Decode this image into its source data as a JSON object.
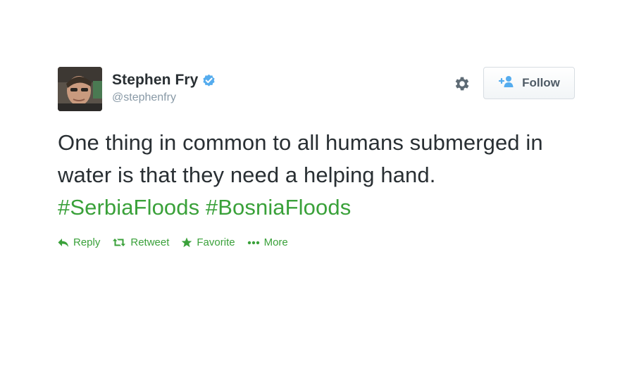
{
  "colors": {
    "accent": "#3aa13a",
    "text": "#292f33",
    "muted": "#8899a6",
    "verified": "#55acee",
    "follow_text": "#4f5b66"
  },
  "user": {
    "full_name": "Stephen Fry",
    "screen_name": "@stephenfry",
    "verified": true,
    "avatar_icon": "avatar"
  },
  "header": {
    "settings_icon": "gear-icon",
    "follow_label": "Follow",
    "follow_icon": "add-user-icon"
  },
  "tweet": {
    "text_main": "One thing in common to all humans submerged in water is that they need a helping hand.",
    "hashtags": [
      "#SerbiaFloods",
      "#BosniaFloods"
    ]
  },
  "actions": [
    {
      "label": "Reply",
      "icon": "reply-icon"
    },
    {
      "label": "Retweet",
      "icon": "retweet-icon"
    },
    {
      "label": "Favorite",
      "icon": "star-icon"
    },
    {
      "label": "More",
      "icon": "more-icon"
    }
  ]
}
